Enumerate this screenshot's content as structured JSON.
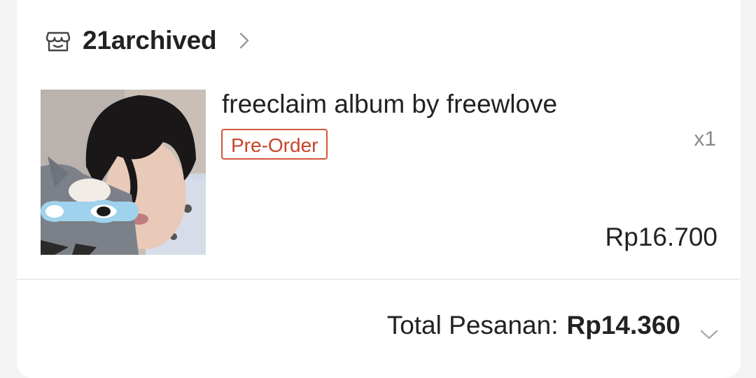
{
  "shop": {
    "name": "21archived",
    "icon": "store-icon"
  },
  "product": {
    "title": "freeclaim album by freewlove",
    "badge": "Pre-Order",
    "quantity": "x1",
    "price": "Rp16.700",
    "thumbnail_icon": "product-thumbnail"
  },
  "order": {
    "total_label": "Total Pesanan:",
    "total_value": "Rp14.360"
  },
  "colors": {
    "accent": "#d4553a",
    "muted": "#888888"
  }
}
